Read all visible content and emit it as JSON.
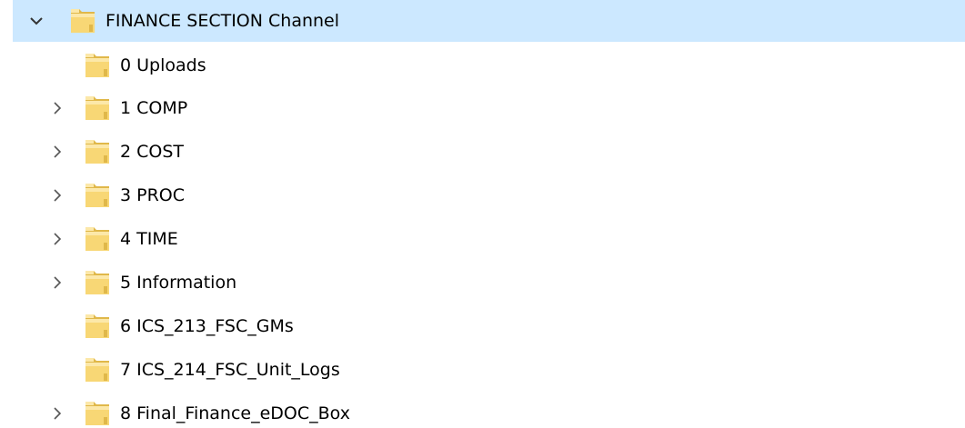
{
  "colors": {
    "selection_background": "#cce8ff",
    "folder_fill": "#f8d775",
    "folder_light": "#fce8a9",
    "folder_shadow": "#e0b84a",
    "chevron": "#555555"
  },
  "icons": {
    "expanded": "chevron-down-icon",
    "collapsed": "chevron-right-icon",
    "folder": "folder-icon"
  },
  "tree": {
    "root": {
      "label": "FINANCE SECTION Channel",
      "expanded": true,
      "selected": true
    },
    "children": [
      {
        "label": "0 Uploads",
        "expandable": false
      },
      {
        "label": "1 COMP",
        "expandable": true
      },
      {
        "label": "2 COST",
        "expandable": true
      },
      {
        "label": "3 PROC",
        "expandable": true
      },
      {
        "label": "4 TIME",
        "expandable": true
      },
      {
        "label": "5 Information",
        "expandable": true
      },
      {
        "label": "6 ICS_213_FSC_GMs",
        "expandable": false
      },
      {
        "label": "7 ICS_214_FSC_Unit_Logs",
        "expandable": false
      },
      {
        "label": "8 Final_Finance_eDOC_Box",
        "expandable": true
      }
    ]
  }
}
